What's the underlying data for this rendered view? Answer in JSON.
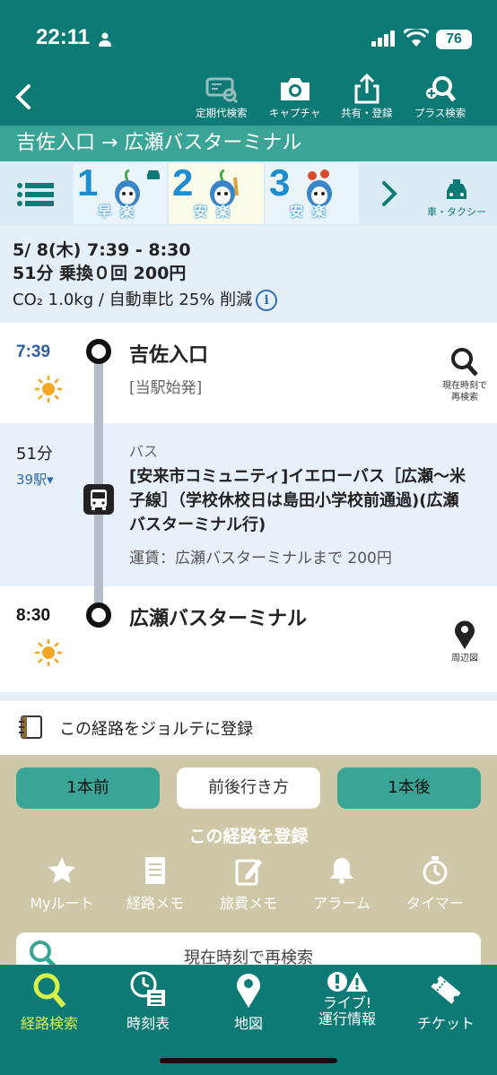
{
  "status_bar": {
    "time": "22:11",
    "battery": "76"
  },
  "toolbar": {
    "back_icon": "chevron-left-icon",
    "items": [
      {
        "label": "定期代検索",
        "icon": "commuter-pass-search-icon"
      },
      {
        "label": "キャプチャ",
        "icon": "camera-icon"
      },
      {
        "label": "共有・登録",
        "icon": "share-icon"
      },
      {
        "label": "プラス検索",
        "icon": "search-plus-icon"
      }
    ]
  },
  "route_title": "吉佐入口 → 広瀬バスターミナル",
  "tabs": [
    {
      "num": "1",
      "label": "早楽"
    },
    {
      "num": "2",
      "label": "安楽"
    },
    {
      "num": "3",
      "label": "安楽"
    }
  ],
  "taxi_label": "車・タクシー",
  "summary": {
    "line1": "5/ 8(木)  7:39 -  8:30",
    "line2": "51分 乗換０回 200円",
    "line3": "CO₂ 1.0kg / 自動車比 25% 削減"
  },
  "departure": {
    "time": "7:39",
    "weather": "sun-icon",
    "name": "吉佐入口",
    "note": "[当駅始発]",
    "action": [
      "現在時刻で",
      "再検索"
    ]
  },
  "ride": {
    "duration": "51分",
    "stations": "39駅▾",
    "type": "バス",
    "name": "[安来市コミュニティ]イエローバス［広瀬～米子線］（学校休校日は島田小学校前通過)(広瀬バスターミナル行)",
    "fare": "運賃：広瀬バスターミナルまで 200円"
  },
  "arrival": {
    "time": "8:30",
    "weather": "sun-icon",
    "name": "広瀬バスターミナル",
    "action": "周辺図"
  },
  "jorte_label": "この経路をジョルテに登録",
  "nav_buttons": {
    "prev": "1本前",
    "mid": "前後行き方",
    "next": "1本後"
  },
  "register": {
    "title": "この経路を登録",
    "items": [
      {
        "label": "Myルート",
        "icon": "star-icon"
      },
      {
        "label": "経路メモ",
        "icon": "memo-icon"
      },
      {
        "label": "旅費メモ",
        "icon": "edit-icon"
      },
      {
        "label": "アラーム",
        "icon": "bell-icon"
      },
      {
        "label": "タイマー",
        "icon": "timer-icon"
      }
    ]
  },
  "research_label": "現在時刻で再検索",
  "bottom_nav": [
    {
      "label": "経路検索",
      "icon": "search-icon",
      "active": true
    },
    {
      "label": "時刻表",
      "icon": "timetable-icon",
      "active": false
    },
    {
      "label": "地図",
      "icon": "map-pin-icon",
      "active": false
    },
    {
      "label_top": "ライブ!",
      "label": "運行情報",
      "icon": "alert-icon",
      "active": false
    },
    {
      "label": "チケット",
      "icon": "ticket-icon",
      "active": false
    }
  ],
  "colors": {
    "primary": "#0e7a76",
    "accent": "#3aa596",
    "panel": "#cfc8a8",
    "active_nav": "#d8f04a",
    "time_blue": "#2f5fa8"
  }
}
